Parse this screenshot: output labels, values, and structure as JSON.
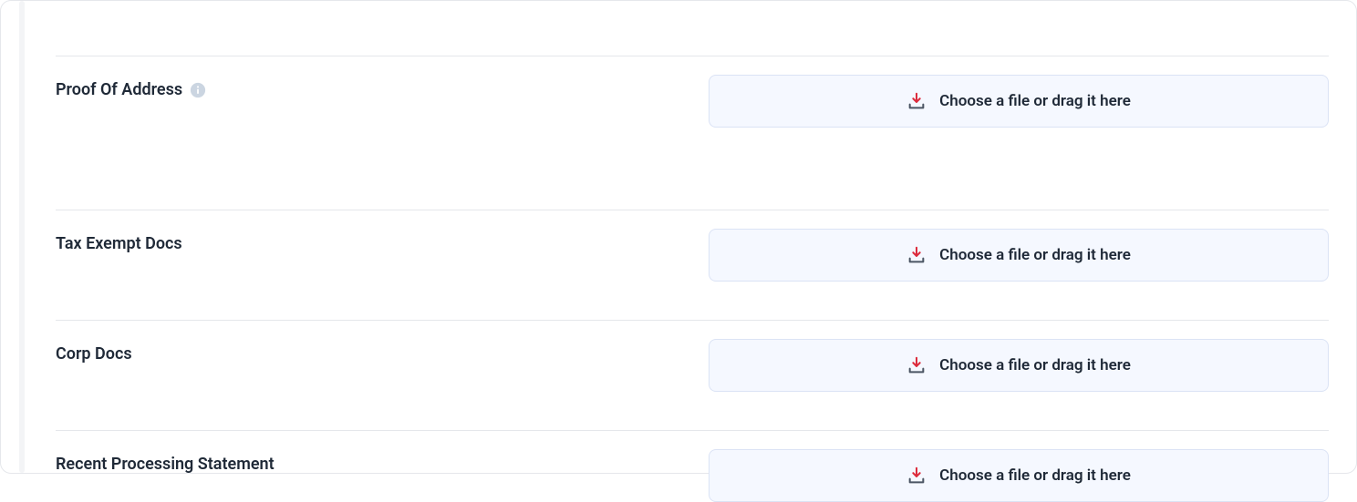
{
  "upload_hint": "Choose a file or drag it here",
  "rows": [
    {
      "label": "Proof Of Address",
      "has_info": true
    },
    {
      "label": "Tax Exempt Docs",
      "has_info": false
    },
    {
      "label": "Corp Docs",
      "has_info": false
    },
    {
      "label": "Recent Processing Statement",
      "has_info": false
    }
  ]
}
